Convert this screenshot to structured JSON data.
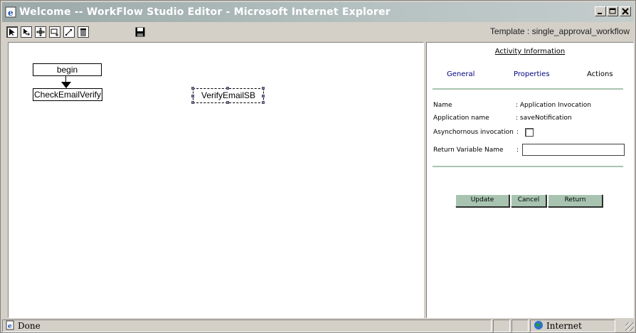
{
  "window": {
    "title": "Welcome -- WorkFlow Studio Editor - Microsoft Internet Explorer"
  },
  "toolbar": {
    "tools": [
      "select-arrow-icon",
      "add-node-icon",
      "move-icon",
      "add-box-icon",
      "connect-icon",
      "delete-icon",
      "save-icon"
    ],
    "template_label": "Template : single_approval_workflow"
  },
  "canvas": {
    "nodes": {
      "begin": "begin",
      "check": "CheckEmailVerify",
      "verify": "VerifyEmailSB"
    }
  },
  "panel": {
    "heading": "Activity Information",
    "tabs": {
      "general": "General",
      "properties": "Properties",
      "actions": "Actions"
    },
    "fields": {
      "name_label": "Name",
      "name_value": ": Application Invocation",
      "app_label": "Application name",
      "app_value": ": saveNotification",
      "async_label": "Asynchornous invocation",
      "return_label": "Return Variable Name",
      "return_value": ""
    },
    "buttons": {
      "update": "Update",
      "cancel": "Cancel",
      "return": "Return"
    }
  },
  "statusbar": {
    "status": "Done",
    "zone": "Internet"
  },
  "colors": {
    "button_face": "#a8c4b0",
    "tab_link": "#000080",
    "titlebar": "#9aa8a8"
  }
}
